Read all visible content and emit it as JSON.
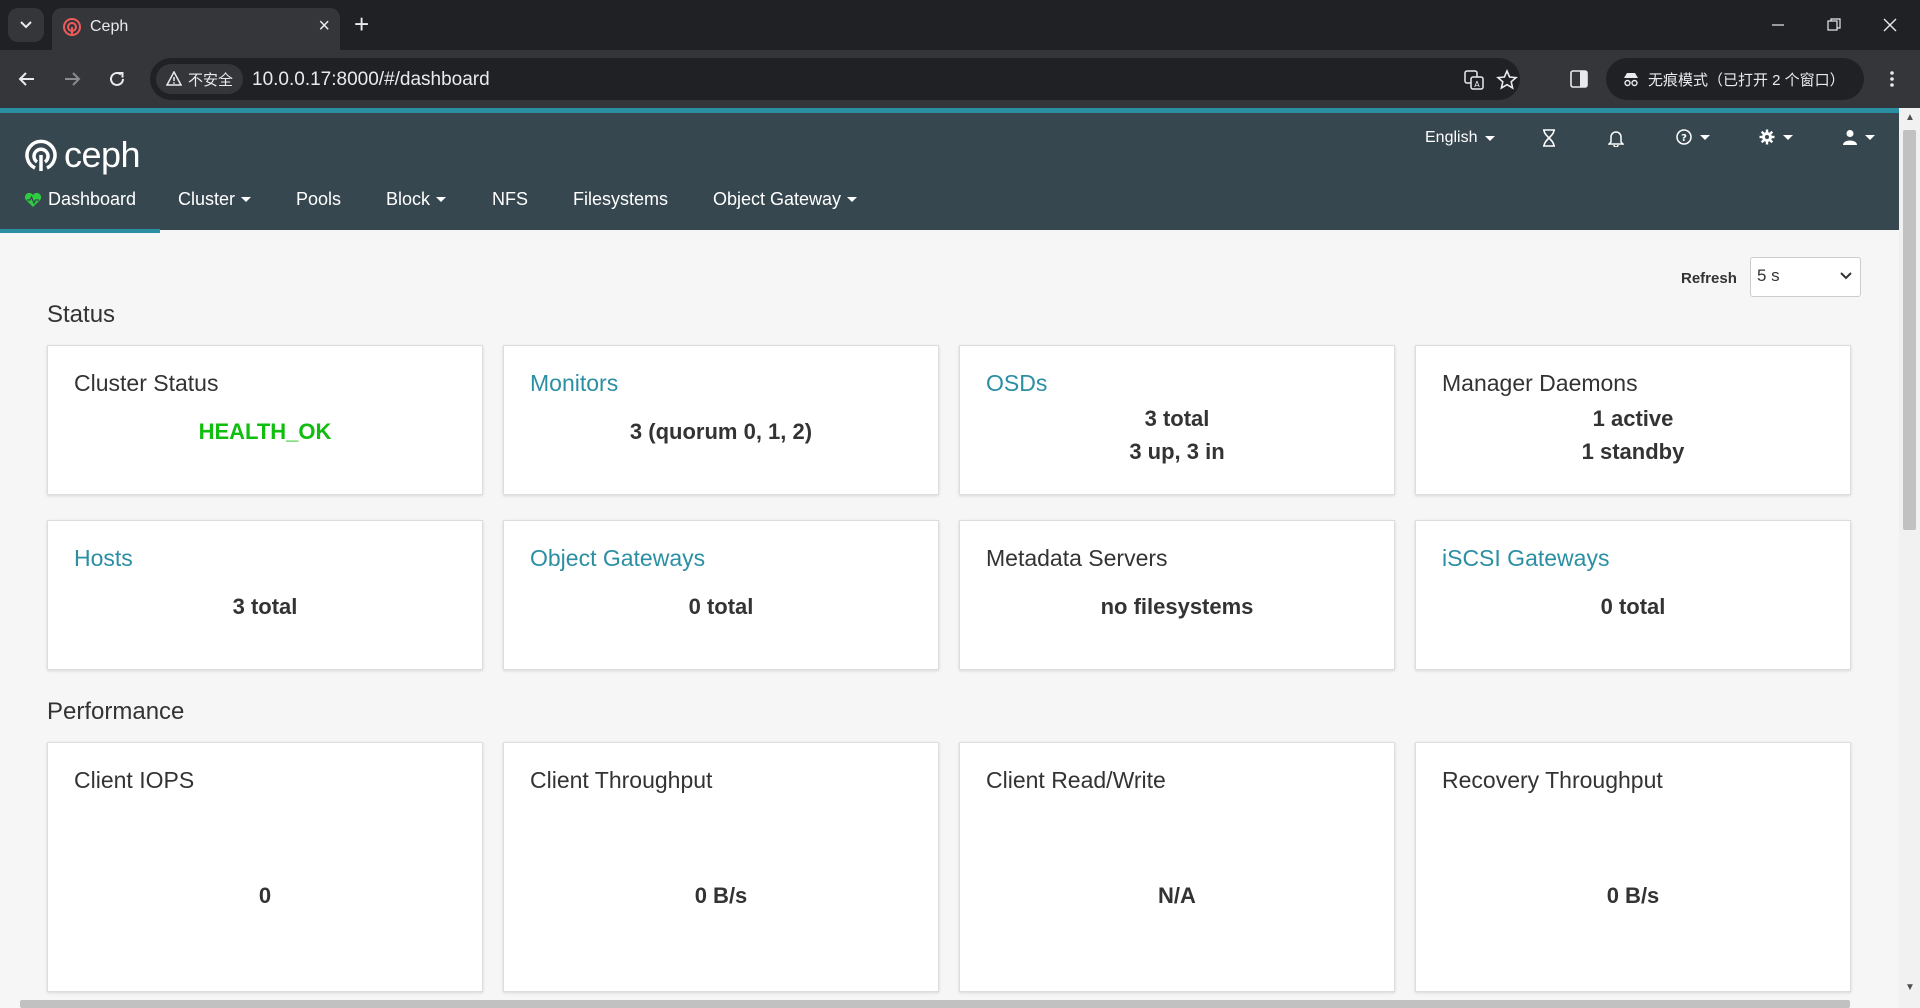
{
  "browser": {
    "tab_title": "Ceph",
    "url": "10.0.0.17:8000/#/dashboard",
    "security_label": "不安全",
    "profile_label": "无痕模式（已打开 2 个窗口）"
  },
  "navbar": {
    "logo_text": "ceph",
    "language": "English",
    "menu": [
      {
        "label": "Dashboard",
        "active": true
      },
      {
        "label": "Cluster",
        "dropdown": true
      },
      {
        "label": "Pools"
      },
      {
        "label": "Block",
        "dropdown": true
      },
      {
        "label": "NFS"
      },
      {
        "label": "Filesystems"
      },
      {
        "label": "Object Gateway",
        "dropdown": true
      }
    ]
  },
  "refresh": {
    "label": "Refresh",
    "value": "5 s"
  },
  "status": {
    "title": "Status",
    "cards": [
      {
        "title": "Cluster Status",
        "lines": [
          "HEALTH_OK"
        ],
        "link": false,
        "status_color": "#0fbe0f"
      },
      {
        "title": "Monitors",
        "lines": [
          "3 (quorum 0, 1, 2)"
        ],
        "link": true
      },
      {
        "title": "OSDs",
        "lines": [
          "3 total",
          "3 up, 3 in"
        ],
        "link": true
      },
      {
        "title": "Manager Daemons",
        "lines": [
          "1 active",
          "1 standby"
        ],
        "link": false
      },
      {
        "title": "Hosts",
        "lines": [
          "3 total"
        ],
        "link": true
      },
      {
        "title": "Object Gateways",
        "lines": [
          "0 total"
        ],
        "link": true
      },
      {
        "title": "Metadata Servers",
        "lines": [
          "no filesystems"
        ],
        "link": false
      },
      {
        "title": "iSCSI Gateways",
        "lines": [
          "0 total"
        ],
        "link": true
      }
    ]
  },
  "performance": {
    "title": "Performance",
    "cards": [
      {
        "title": "Client IOPS",
        "value": "0"
      },
      {
        "title": "Client Throughput",
        "value": "0 B/s"
      },
      {
        "title": "Client Read/Write",
        "value": "N/A"
      },
      {
        "title": "Recovery Throughput",
        "value": "0 B/s"
      }
    ]
  },
  "colors": {
    "accent": "#2b8fa4",
    "navbar": "#37474f",
    "health_ok": "#0fbe0f"
  }
}
